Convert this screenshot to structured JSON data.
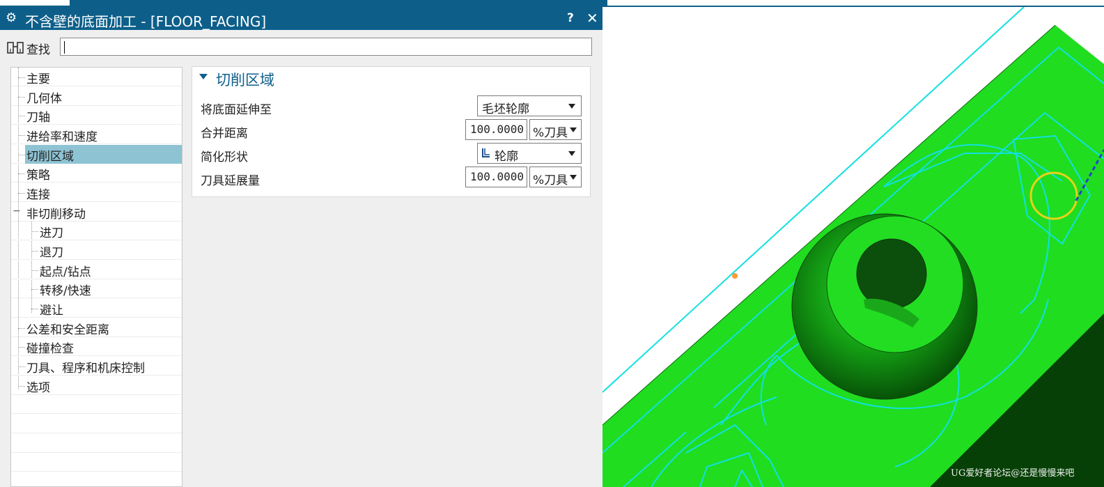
{
  "window": {
    "title": "不含壁的底面加工 - [FLOOR_FACING]",
    "help_label": "?",
    "close_label": "✕",
    "gear_glyph": "⚙"
  },
  "search": {
    "label": "查找",
    "value": ""
  },
  "tree": {
    "items": [
      {
        "label": "主要"
      },
      {
        "label": "几何体"
      },
      {
        "label": "刀轴"
      },
      {
        "label": "进给率和速度"
      },
      {
        "label": "切削区域"
      },
      {
        "label": "策略"
      },
      {
        "label": "连接"
      },
      {
        "label": "非切削移动"
      },
      {
        "label": "进刀"
      },
      {
        "label": "退刀"
      },
      {
        "label": "起点/钻点"
      },
      {
        "label": "转移/快速"
      },
      {
        "label": "避让"
      },
      {
        "label": "公差和安全距离"
      },
      {
        "label": "碰撞检查"
      },
      {
        "label": "刀具、程序和机床控制"
      },
      {
        "label": "选项"
      }
    ],
    "selected": "切削区域"
  },
  "panel": {
    "section_title": "切削区域",
    "rows": [
      {
        "label": "将底面延伸至",
        "select": "毛坯轮廓"
      },
      {
        "label": "合并距离",
        "value": "100.0000",
        "unit": "%刀具"
      },
      {
        "label": "简化形状",
        "select": "轮廓"
      },
      {
        "label": "刀具延展量",
        "value": "100.0000",
        "unit": "%刀具"
      }
    ]
  },
  "viewport": {
    "watermark": "UG爱好者论坛@还是慢慢来吧"
  },
  "colors": {
    "title_bar": "#0d5f8a",
    "selection": "#8ec3d4",
    "part_green": "#22dd22",
    "toolpath": "#00e5e5"
  }
}
